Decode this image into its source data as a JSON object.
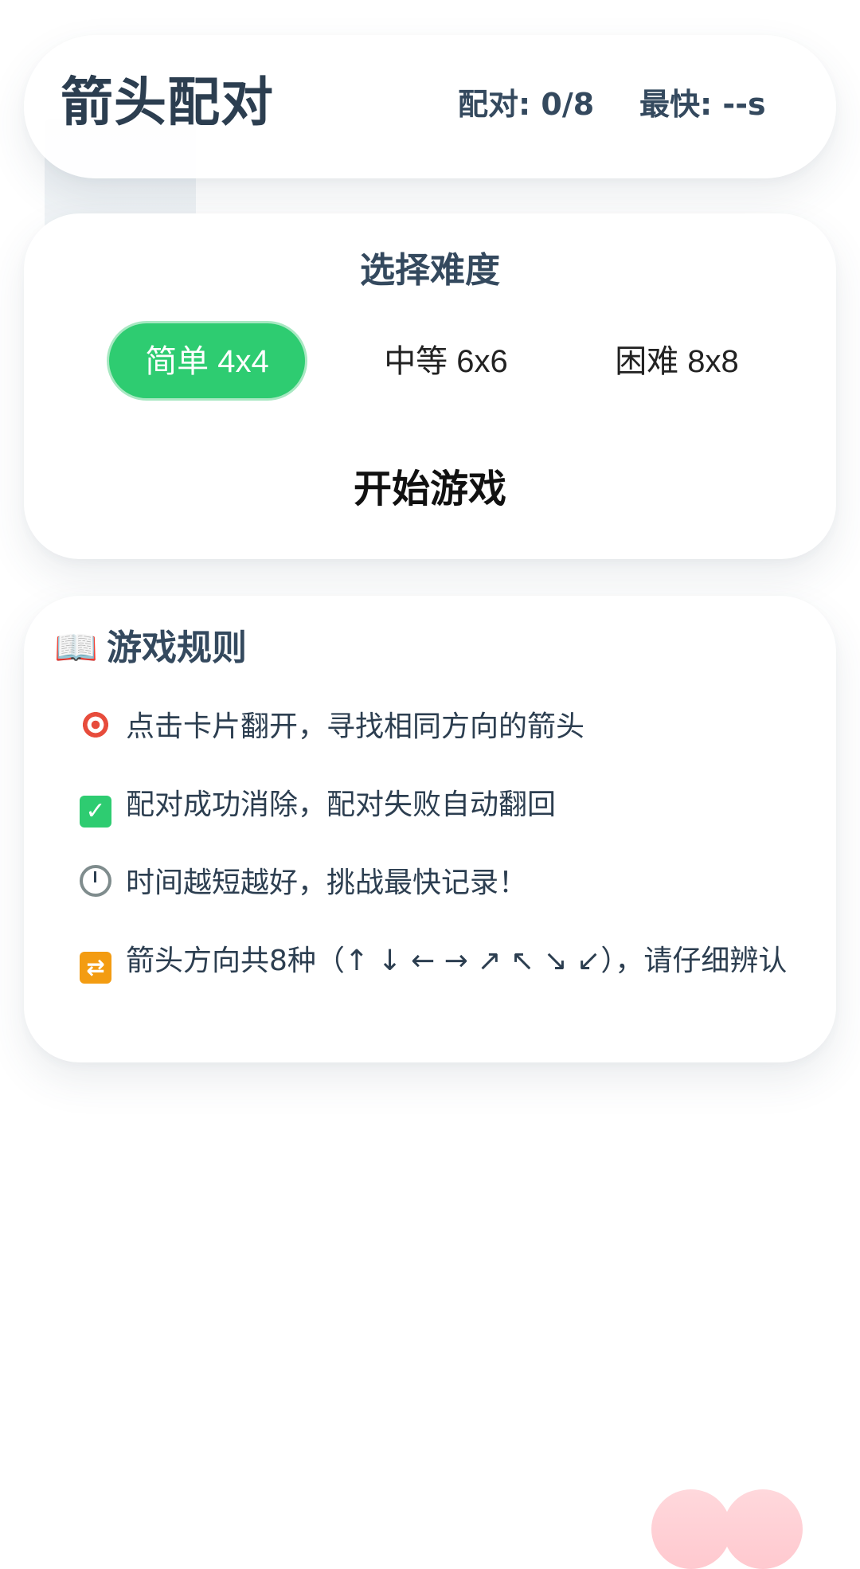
{
  "header": {
    "title": "箭头配对",
    "pairs": "配对: 0/8",
    "best": "最快: --s"
  },
  "difficulty": {
    "title": "选择难度",
    "options": [
      {
        "label": "简单 4x4",
        "selected": true
      },
      {
        "label": "中等 6x6",
        "selected": false
      },
      {
        "label": "困难 8x8",
        "selected": false
      }
    ],
    "start_label": "开始游戏"
  },
  "rules": {
    "title_emoji": "📖",
    "title": "游戏规则",
    "items": [
      {
        "icon": "target-icon",
        "text": "点击卡片翻开，寻找相同方向的箭头"
      },
      {
        "icon": "check-icon",
        "text": "配对成功消除，配对失败自动翻回"
      },
      {
        "icon": "stopwatch-icon",
        "text": "时间越短越好，挑战最快记录！"
      },
      {
        "icon": "repeat-icon",
        "text": "箭头方向共8种（↑ ↓ ← → ↗ ↖ ↘ ↙），请仔细辨认"
      }
    ]
  },
  "colors": {
    "accent": "#2ecc71",
    "text": "#2c3e50"
  }
}
